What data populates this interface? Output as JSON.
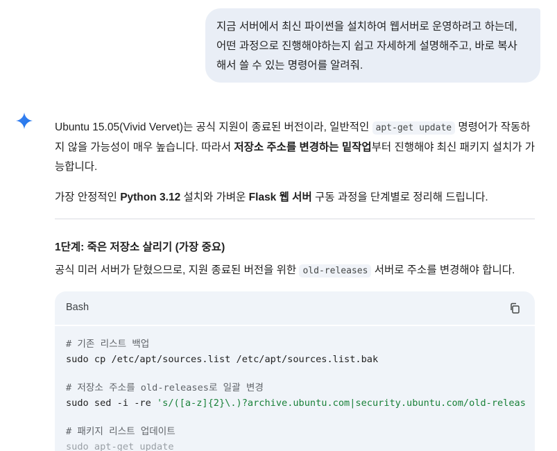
{
  "user_message": {
    "text": "지금 서버에서 최신 파이썬을 설치하여 웹서버로 운영하려고 하는데,\n어떤 과정으로 진행해야하는지 쉽고 자세하게 설명해주고, 바로 복사\n해서 쓸 수 있는 명령어를 알려줘."
  },
  "assistant": {
    "icon": "sparkle-icon",
    "para1": {
      "t1": "Ubuntu 15.05(Vivid Vervet)는 공식 지원이 종료된 버전이라, 일반적인 ",
      "code": "apt-get update",
      "t2": " 명령어가 작동하지 않을 가능성이 매우 높습니다. 따라서 ",
      "bold": "저장소 주소를 변경하는 밑작업",
      "t3": "부터 진행해야 최신 패키지 설치가 가능합니다."
    },
    "para2": {
      "t1": "가장 안정적인 ",
      "bold1": "Python 3.12",
      "t2": " 설치와 가벼운 ",
      "bold2": "Flask 웹 서버",
      "t3": " 구동 과정을 단계별로 정리해 드립니다."
    },
    "step1": {
      "title": "1단계: 죽은 저장소 살리기 (가장 중요)",
      "desc_t1": "공식 미러 서버가 닫혔으므로, 지원 종료된 버전을 위한 ",
      "desc_code": "old-releases",
      "desc_t2": " 서버로 주소를 변경해야 합니다."
    },
    "code_block": {
      "language": "Bash",
      "copy_icon": "copy-icon",
      "lines": {
        "c1": "# 기존 리스트 백업",
        "l1": "sudo cp /etc/apt/sources.list /etc/apt/sources.list.bak",
        "c2": "# 저장소 주소를 old-releases로 일괄 변경",
        "l2a": "sudo sed -i -re ",
        "l2b": "'s/([a-z]{2}\\.)?archive.ubuntu.com|security.ubuntu.com/old-releas",
        "c3": "# 패키지 리스트 업데이트",
        "l3": "sudo apt-get update"
      }
    }
  },
  "colors": {
    "bubble_bg": "#e9eef6",
    "code_bg": "#f0f4f9",
    "string": "#188038",
    "sparkle": "#4285f4"
  }
}
